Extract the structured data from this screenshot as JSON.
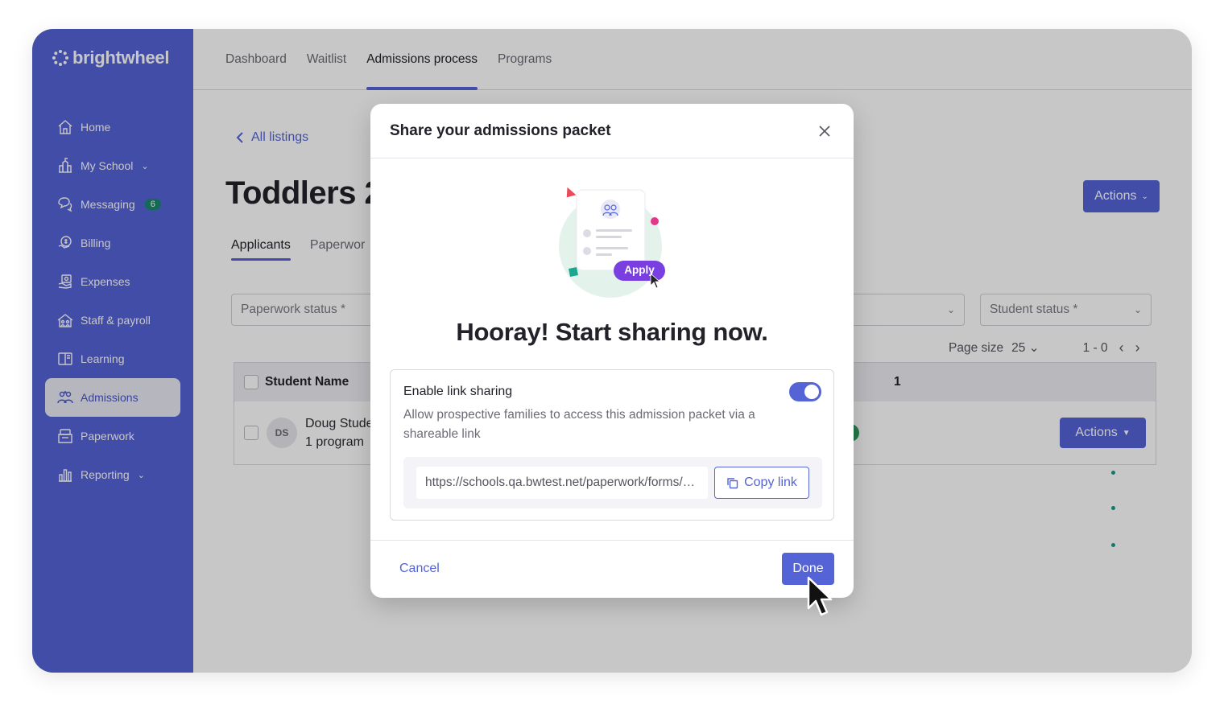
{
  "brand": {
    "name": "brightwheel"
  },
  "sidebar": {
    "items": [
      {
        "label": "Home",
        "icon": "home-icon"
      },
      {
        "label": "My School",
        "icon": "school-icon",
        "has_chevron": true
      },
      {
        "label": "Messaging",
        "icon": "chat-icon",
        "badge": "6"
      },
      {
        "label": "Billing",
        "icon": "billing-icon"
      },
      {
        "label": "Expenses",
        "icon": "expenses-icon"
      },
      {
        "label": "Staff & payroll",
        "icon": "staff-icon"
      },
      {
        "label": "Learning",
        "icon": "learning-icon"
      },
      {
        "label": "Admissions",
        "icon": "admissions-icon",
        "active": true
      },
      {
        "label": "Paperwork",
        "icon": "paperwork-icon"
      },
      {
        "label": "Reporting",
        "icon": "reporting-icon",
        "has_chevron": true
      }
    ]
  },
  "topnav": {
    "tabs": [
      {
        "label": "Dashboard"
      },
      {
        "label": "Waitlist"
      },
      {
        "label": "Admissions process",
        "active": true
      },
      {
        "label": "Programs"
      }
    ]
  },
  "page": {
    "back_label": "All listings",
    "title": "Toddlers 2",
    "tabs": [
      {
        "label": "Applicants",
        "active": true
      },
      {
        "label": "Paperwor"
      }
    ],
    "actions_label": "Actions",
    "filters": {
      "paperwork_status": "Paperwork status *",
      "student_status": "Student status *"
    },
    "pager": {
      "page_size_label": "Page size",
      "page_size": "25",
      "range": "1 - 0"
    },
    "table": {
      "header": {
        "student_name": "Student Name",
        "partial_col": "1"
      },
      "rows": [
        {
          "initials": "DS",
          "name": "Doug Stude",
          "programs": "1 program",
          "actions_label": "Actions"
        }
      ]
    }
  },
  "modal": {
    "title": "Share your admissions packet",
    "illustration_badge": "Apply",
    "headline": "Hooray! Start sharing now.",
    "share": {
      "title": "Enable link sharing",
      "description": "Allow prospective families to access this admission packet via a shareable link",
      "enabled": true,
      "url": "https://schools.qa.bwtest.net/paperwork/forms/admissions-packet",
      "copy_label": "Copy link"
    },
    "cancel_label": "Cancel",
    "done_label": "Done"
  },
  "colors": {
    "brand": "#5463d6",
    "accent_pink": "#e6368a",
    "accent_teal": "#1aa690",
    "success": "#2f9a5f"
  }
}
